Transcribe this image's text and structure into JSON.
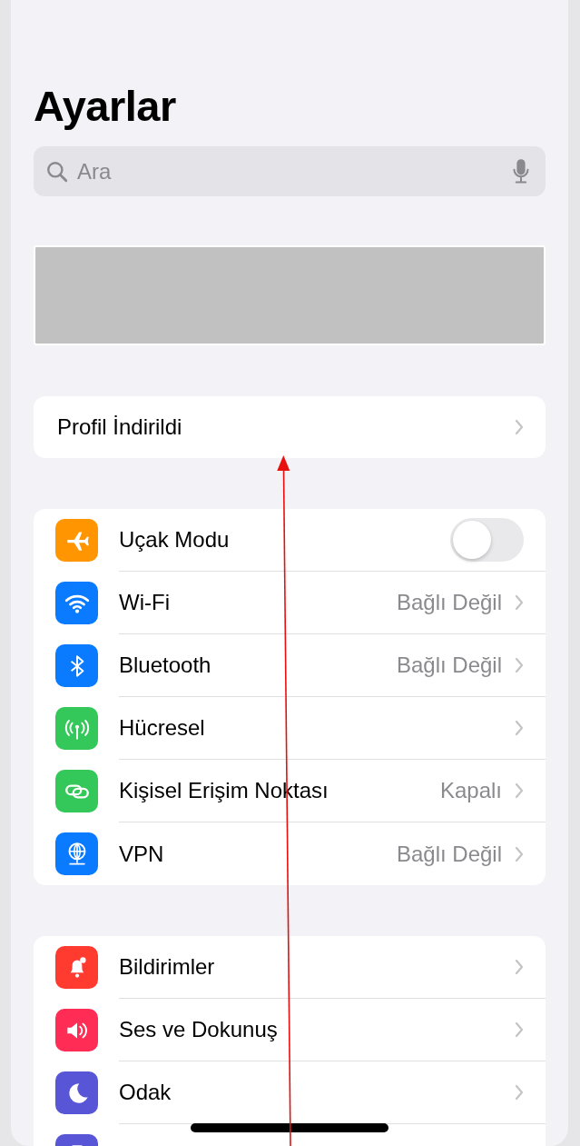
{
  "title": "Ayarlar",
  "search": {
    "placeholder": "Ara"
  },
  "profile_row": {
    "label": "Profil İndirildi"
  },
  "groups": [
    {
      "items": [
        {
          "kind": "toggle",
          "label": "Uçak Modu",
          "color": "#ff9500",
          "on": false
        },
        {
          "kind": "link",
          "label": "Wi-Fi",
          "value": "Bağlı Değil",
          "color": "#0a7aff"
        },
        {
          "kind": "link",
          "label": "Bluetooth",
          "value": "Bağlı Değil",
          "color": "#0a7aff"
        },
        {
          "kind": "link",
          "label": "Hücresel",
          "color": "#34c759"
        },
        {
          "kind": "link",
          "label": "Kişisel Erişim Noktası",
          "value": "Kapalı",
          "color": "#34c759"
        },
        {
          "kind": "link",
          "label": "VPN",
          "value": "Bağlı Değil",
          "color": "#0a7aff"
        }
      ]
    },
    {
      "items": [
        {
          "kind": "link",
          "label": "Bildirimler",
          "color": "#ff3b30"
        },
        {
          "kind": "link",
          "label": "Ses ve Dokunuş",
          "color": "#ff2d55"
        },
        {
          "kind": "link",
          "label": "Odak",
          "color": "#5856d6"
        },
        {
          "kind": "cut",
          "color": "#5856d6"
        }
      ]
    }
  ]
}
